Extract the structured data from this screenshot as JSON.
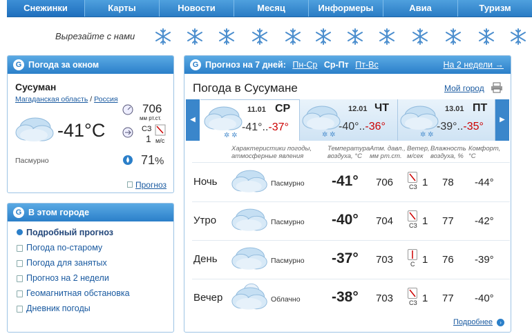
{
  "nav": [
    "Снежинки",
    "Карты",
    "Новости",
    "Месяц",
    "Информеры",
    "Авиа",
    "Туризм"
  ],
  "slogan": "Вырезайте с нами",
  "left_panel": {
    "title": "Погода за окном",
    "city": "Сусуман",
    "region": "Магаданская область",
    "country": "Россия",
    "temp": "-41°C",
    "pressure": "706",
    "pressure_unit": "мм рт.ст.",
    "wind_dir": "СЗ",
    "wind_speed": "1",
    "wind_unit": "м/с",
    "humidity": "71",
    "humidity_unit": "%",
    "desc": "Пасмурно",
    "forecast_link": "Прогноз"
  },
  "city_panel": {
    "title": "В этом городе",
    "items": [
      "Подробный прогноз",
      "Погода по-старому",
      "Погода для занятых",
      "Прогноз на 2 недели",
      "Геомагнитная обстановка",
      "Дневник погоды"
    ]
  },
  "forecast": {
    "title": "Прогноз на 7 дней:",
    "tabs": [
      "Пн-Ср",
      "Ср-Пт",
      "Пт-Вс"
    ],
    "two_weeks": "На 2 недели →",
    "heading": "Погода в Сусумане",
    "my_city": "Мой город",
    "days": [
      {
        "date": "11.01",
        "dow": "СР",
        "tmin": "-41°..",
        "tmax": "-37°"
      },
      {
        "date": "12.01",
        "dow": "ЧТ",
        "tmin": "-40°..",
        "tmax": "-36°"
      },
      {
        "date": "13.01",
        "dow": "ПТ",
        "tmin": "-39°..",
        "tmax": "-35°"
      }
    ],
    "headers": {
      "desc": "Характеристики погоды, атмосферные явления",
      "temp": "Температура воздуха, °C",
      "press": "Атм. давл., мм рт.ст.",
      "wind": "Ветер, м/сек",
      "hum": "Влажность воздуха, %",
      "comf": "Комфорт, °C"
    },
    "rows": [
      {
        "name": "Ночь",
        "desc": "Пасмурно",
        "temp": "-41°",
        "press": "706",
        "wdir": "СЗ",
        "wind": "1",
        "hum": "78",
        "comf": "-44°"
      },
      {
        "name": "Утро",
        "desc": "Пасмурно",
        "temp": "-40°",
        "press": "704",
        "wdir": "СЗ",
        "wind": "1",
        "hum": "77",
        "comf": "-42°"
      },
      {
        "name": "День",
        "desc": "Пасмурно",
        "temp": "-37°",
        "press": "703",
        "wdir": "С",
        "wind": "1",
        "hum": "76",
        "comf": "-39°"
      },
      {
        "name": "Вечер",
        "desc": "Облачно",
        "temp": "-38°",
        "press": "703",
        "wdir": "СЗ",
        "wind": "1",
        "hum": "77",
        "comf": "-40°"
      }
    ],
    "more": "Подробнее"
  }
}
